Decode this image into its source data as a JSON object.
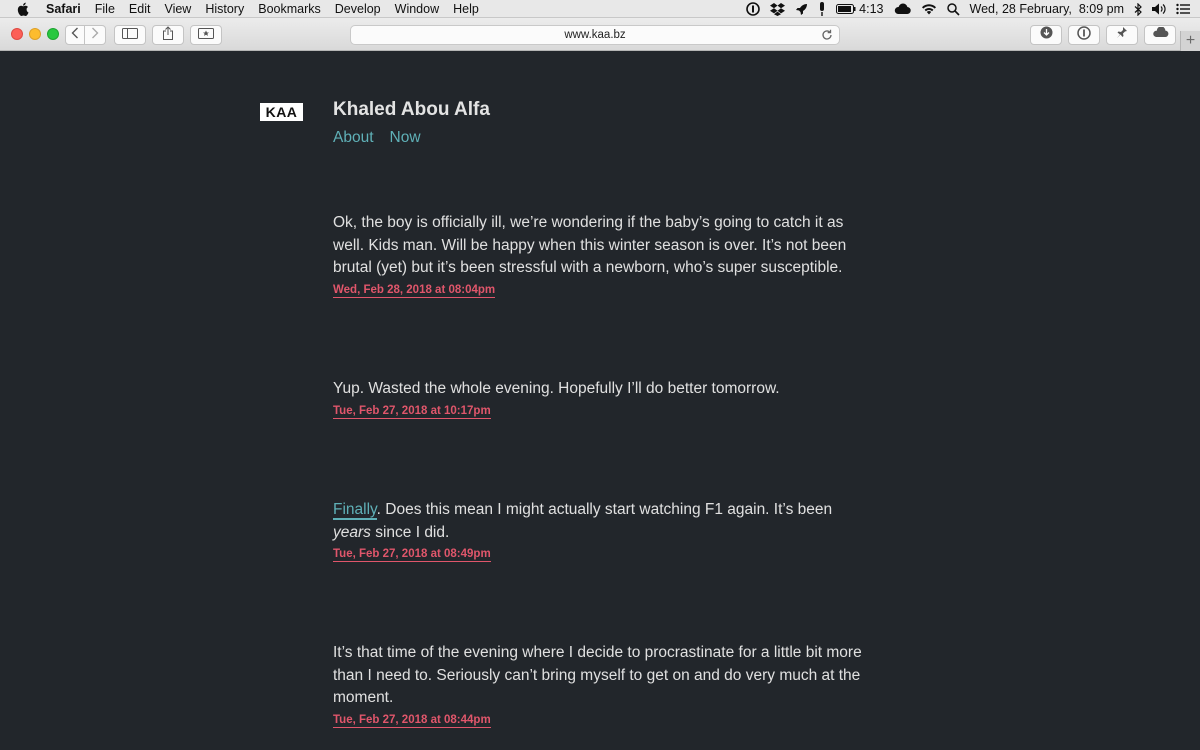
{
  "menubar": {
    "app_name": "Safari",
    "items": [
      "File",
      "Edit",
      "View",
      "History",
      "Bookmarks",
      "Develop",
      "Window",
      "Help"
    ],
    "battery_time": "4:13",
    "datetime": "Wed, 28 February,  8:09 pm"
  },
  "browser": {
    "url": "www.kaa.bz",
    "new_tab_label": "+"
  },
  "site": {
    "logo_text": "KAA",
    "title": "Khaled Abou Alfa",
    "nav": [
      "About",
      "Now"
    ]
  },
  "posts": [
    {
      "text": "Ok, the boy is officially ill, we’re wondering if the baby’s going to catch it as well. Kids man. Will be happy when this winter season is over. It’s not been brutal (yet) but it’s been stressful with a newborn, who’s super susceptible.",
      "date": "Wed, Feb 28, 2018 at 08:04pm"
    },
    {
      "text": "Yup. Wasted the whole evening. Hopefully I’ll do better tomorrow.",
      "date": "Tue, Feb 27, 2018 at 10:17pm"
    },
    {
      "link_text": "Finally",
      "text_before_em": ". Does this mean I might actually start watching F1 again. It’s been ",
      "em_text": "years",
      "text_after_em": " since I did.",
      "date": "Tue, Feb 27, 2018 at 08:49pm"
    },
    {
      "text": "It’s that time of the evening where I decide to procrastinate for a little bit more than I need to. Seriously can’t bring myself to get on and do very much at the moment.",
      "date": "Tue, Feb 27, 2018 at 08:44pm"
    }
  ],
  "colors": {
    "background": "#22262b",
    "link": "#5fb0b7",
    "date": "#e0566b",
    "text": "#e0e0e0"
  }
}
